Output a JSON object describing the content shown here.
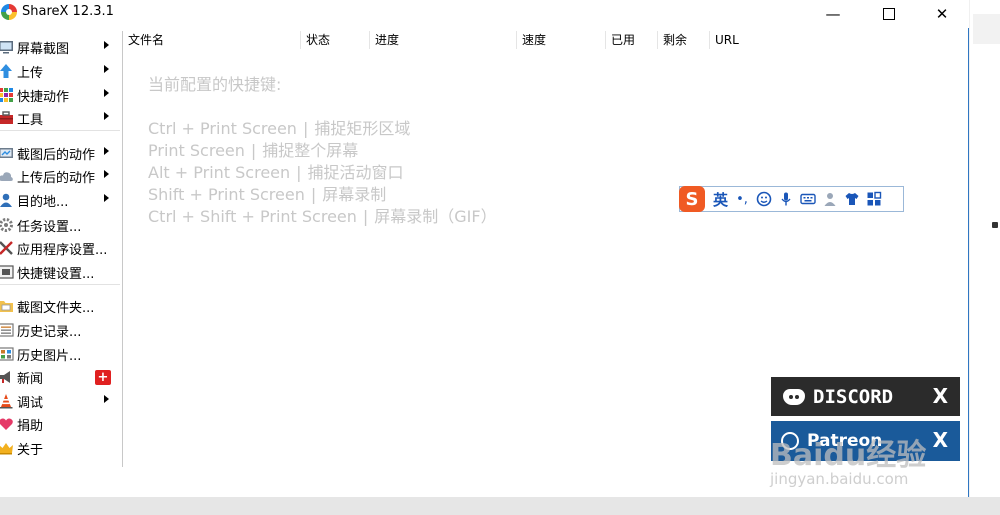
{
  "window": {
    "title": "ShareX 12.3.1",
    "min_glyph": "—",
    "close_glyph": "✕"
  },
  "sidebar": {
    "items": [
      {
        "label": "屏幕截图",
        "icon": "monitor-capture-icon",
        "arrow": true
      },
      {
        "label": "上传",
        "icon": "upload-arrow-icon",
        "arrow": true
      },
      {
        "label": "快捷动作",
        "icon": "grid-actions-icon",
        "arrow": true
      },
      {
        "label": "工具",
        "icon": "toolbox-icon",
        "arrow": true
      },
      {
        "label": "截图后的动作",
        "icon": "after-capture-icon",
        "arrow": true
      },
      {
        "label": "上传后的动作",
        "icon": "cloud-icon",
        "arrow": true
      },
      {
        "label": "目的地...",
        "icon": "user-destination-icon",
        "arrow": true
      },
      {
        "label": "任务设置...",
        "icon": "gear-icon",
        "arrow": false
      },
      {
        "label": "应用程序设置...",
        "icon": "tools-cross-icon",
        "arrow": false
      },
      {
        "label": "快捷键设置...",
        "icon": "keyboard-icon",
        "arrow": false
      },
      {
        "label": "截图文件夹...",
        "icon": "folder-icon",
        "arrow": false
      },
      {
        "label": "历史记录...",
        "icon": "history-list-icon",
        "arrow": false
      },
      {
        "label": "历史图片...",
        "icon": "image-history-icon",
        "arrow": false
      },
      {
        "label": "新闻",
        "icon": "megaphone-icon",
        "arrow": false
      },
      {
        "label": "调试",
        "icon": "traffic-cone-icon",
        "arrow": true
      },
      {
        "label": "捐助",
        "icon": "heart-icon",
        "arrow": false
      },
      {
        "label": "关于",
        "icon": "crown-icon",
        "arrow": false
      }
    ],
    "news_badge": "+"
  },
  "columns": [
    "文件名",
    "状态",
    "进度",
    "速度",
    "已用",
    "剩余",
    "URL"
  ],
  "hints": {
    "title": "当前配置的快捷键:",
    "separator": "|",
    "hotkeys": [
      {
        "keys": "Ctrl + Print Screen",
        "action": "捕捉矩形区域"
      },
      {
        "keys": "Print Screen",
        "action": "捕捉整个屏幕"
      },
      {
        "keys": "Alt + Print Screen",
        "action": "捕捉活动窗口"
      },
      {
        "keys": "Shift + Print Screen",
        "action": "屏幕录制"
      },
      {
        "keys": "Ctrl + Shift + Print Screen",
        "action": "屏幕录制（GIF）"
      }
    ]
  },
  "ime": {
    "logo": "S",
    "lang": "英",
    "punct": "•,"
  },
  "banners": {
    "discord": "DISCORD",
    "patreon": "Patreon",
    "close": "X"
  },
  "watermark": {
    "line1": "Baidu经验",
    "line2": "jingyan.baidu.com"
  },
  "colors": {
    "discord_bg": "#2b2b2b",
    "patreon_bg": "#1a5a9a",
    "hint_text": "#c8c8c8",
    "news_badge": "#e02020",
    "window_border": "#2f76c2"
  }
}
